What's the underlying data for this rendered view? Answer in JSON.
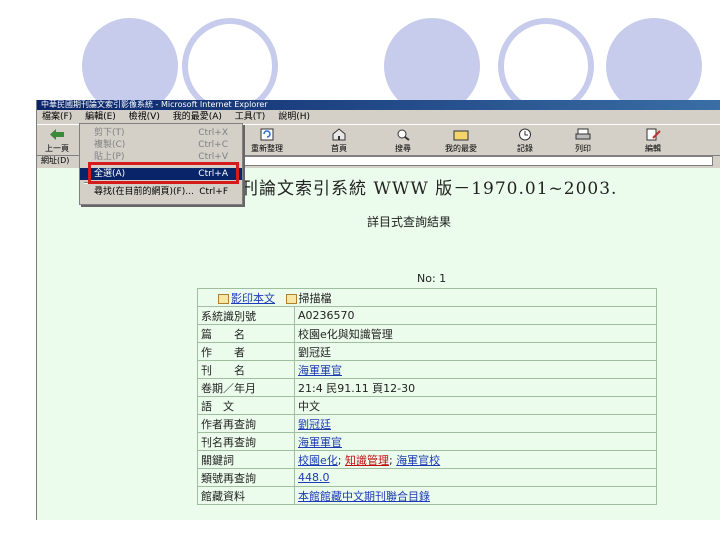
{
  "window": {
    "title": "中華民國期刊論文索引影像系統 - Microsoft Internet Explorer"
  },
  "menu": [
    "檔案(F)",
    "編輯(E)",
    "檢視(V)",
    "我的最愛(A)",
    "工具(T)",
    "說明(H)"
  ],
  "toolbar": {
    "back": "上一頁",
    "refresh": "重新整理",
    "home": "首頁",
    "search": "搜尋",
    "favorites": "我的最愛",
    "history": "記錄",
    "print": "列印",
    "edit": "編輯"
  },
  "address_label": "網址(D)",
  "dropdown": [
    {
      "label": "剪下(T)",
      "shortcut": "Ctrl+X"
    },
    {
      "label": "複製(C)",
      "shortcut": "Ctrl+C"
    },
    {
      "label": "貼上(P)",
      "shortcut": "Ctrl+V"
    },
    {
      "label": "全選(A)",
      "shortcut": "Ctrl+A"
    },
    {
      "label": "尋找(在目前的網頁)(F)...",
      "shortcut": "Ctrl+F"
    }
  ],
  "page": {
    "title": "期刊論文索引系統 WWW 版－1970.01~2003.",
    "subtitle": "詳目式查詢結果",
    "record_no": "No: 1",
    "links": {
      "image_fulltext": "影印本文",
      "scan_file": "掃描檔"
    }
  },
  "record": {
    "system_id": {
      "key": "系統識別號",
      "value": "A0236570"
    },
    "article": {
      "key": "篇　　名",
      "value": "校園e化與知識管理"
    },
    "author": {
      "key": "作　　者",
      "value": "劉冠廷"
    },
    "journal": {
      "key": "刊　　名",
      "value": "海軍軍官"
    },
    "volume": {
      "key": "卷期／年月",
      "value": "21:4 民91.11 頁12-30"
    },
    "language": {
      "key": "語　文",
      "value": "中文"
    },
    "author_search": {
      "key": "作者再查詢",
      "value": "劉冠廷"
    },
    "journal_search": {
      "key": "刊名再查詢",
      "value": "海軍軍官"
    },
    "keywords": {
      "key": "關鍵詞",
      "items": [
        "校園e化",
        "知識管理",
        "海軍官校"
      ]
    },
    "class_search": {
      "key": "類號再查詢",
      "value": "448.0"
    },
    "holdings": {
      "key": "館藏資料",
      "value": "本館館藏中文期刊聯合目錄"
    }
  }
}
